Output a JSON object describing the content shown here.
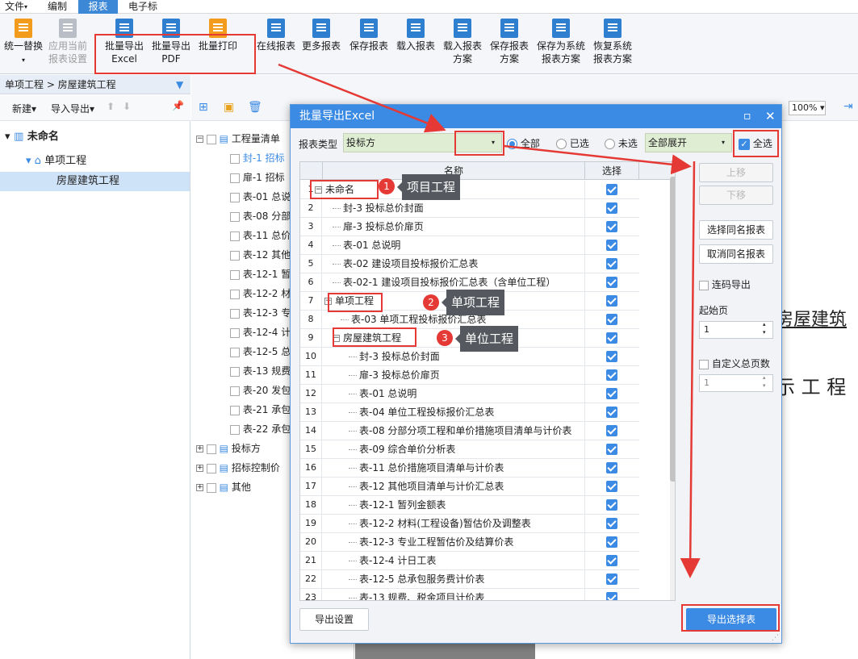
{
  "menu": [
    "文件",
    "编制",
    "报表",
    "电子标"
  ],
  "ribbon": {
    "b1": "统一替换",
    "b2a": "应用当前",
    "b2b": "报表设置",
    "b3a": "批量导出",
    "b3b": "Excel",
    "b4a": "批量导出",
    "b4b": "PDF",
    "b5": "批量打印",
    "b6": "在线报表",
    "b7": "更多报表",
    "b8": "保存报表",
    "b9": "载入报表",
    "b10a": "载入报表",
    "b10b": "方案",
    "b11a": "保存报表",
    "b11b": "方案",
    "b12a": "保存为系统",
    "b12b": "报表方案",
    "b13a": "恢复系统",
    "b13b": "报表方案"
  },
  "breadcrumb": "单项工程 > 房屋建筑工程",
  "side_tool": {
    "new": "新建",
    "io": "导入导出"
  },
  "side_tree": [
    "未命名",
    "单项工程",
    "房屋建筑工程"
  ],
  "zoom": "100%",
  "report_list": [
    "工程量清单",
    "封-1 招标",
    "扉-1 招标",
    "表-01 总说",
    "表-08 分部",
    "表-11 总价",
    "表-12 其他",
    "表-12-1 暂",
    "表-12-2 材",
    "表-12-3 专",
    "表-12-4 计",
    "表-12-5 总",
    "表-13 规费",
    "表-20 发包",
    "表-21 承包",
    "表-22 承包",
    "投标方",
    "招标控制价",
    "其他"
  ],
  "paper_text": {
    "line1": "房屋建筑",
    "line2": "示 工 程"
  },
  "dialog": {
    "title": "批量导出Excel",
    "type_label": "报表类型",
    "type_value": "投标方",
    "filter": [
      "全部",
      "已选",
      "未选"
    ],
    "expand": "全部展开",
    "select_all": "全选",
    "col_name": "名称",
    "col_select": "选择",
    "rows": [
      {
        "no": "1",
        "name": "未命名",
        "level": 0,
        "group": true
      },
      {
        "no": "2",
        "name": "封-3 投标总价封面",
        "level": 1
      },
      {
        "no": "3",
        "name": "扉-3 投标总价扉页",
        "level": 1
      },
      {
        "no": "4",
        "name": "表-01 总说明",
        "level": 1
      },
      {
        "no": "5",
        "name": "表-02 建设项目投标报价汇总表",
        "level": 1
      },
      {
        "no": "6",
        "name": "表-02-1 建设项目投标报价汇总表（含单位工程）",
        "level": 1
      },
      {
        "no": "7",
        "name": "单项工程",
        "level": 1,
        "group": true
      },
      {
        "no": "8",
        "name": "表-03 单项工程投标报价汇总表",
        "level": 2
      },
      {
        "no": "9",
        "name": "房屋建筑工程",
        "level": 2,
        "group": true
      },
      {
        "no": "10",
        "name": "封-3 投标总价封面",
        "level": 3
      },
      {
        "no": "11",
        "name": "扉-3 投标总价扉页",
        "level": 3
      },
      {
        "no": "12",
        "name": "表-01 总说明",
        "level": 3
      },
      {
        "no": "13",
        "name": "表-04 单位工程投标报价汇总表",
        "level": 3
      },
      {
        "no": "14",
        "name": "表-08 分部分项工程和单价措施项目清单与计价表",
        "level": 3
      },
      {
        "no": "15",
        "name": "表-09 综合单价分析表",
        "level": 3
      },
      {
        "no": "16",
        "name": "表-11 总价措施项目清单与计价表",
        "level": 3
      },
      {
        "no": "17",
        "name": "表-12 其他项目清单与计价汇总表",
        "level": 3
      },
      {
        "no": "18",
        "name": "表-12-1 暂列金额表",
        "level": 3
      },
      {
        "no": "19",
        "name": "表-12-2 材料(工程设备)暂估价及调整表",
        "level": 3
      },
      {
        "no": "20",
        "name": "表-12-3 专业工程暂估价及结算价表",
        "level": 3
      },
      {
        "no": "21",
        "name": "表-12-4 计日工表",
        "level": 3
      },
      {
        "no": "22",
        "name": "表-12-5 总承包服务费计价表",
        "level": 3
      },
      {
        "no": "23",
        "name": "表-13 规费、税金项目计价表",
        "level": 3
      }
    ],
    "up": "上移",
    "down": "下移",
    "sel_same": "选择同名报表",
    "cancel_same": "取消同名报表",
    "continuous": "连码导出",
    "start_page": "起始页",
    "start_value": "1",
    "custom_total": "自定义总页数",
    "total_value": "1",
    "export_settings": "导出设置",
    "export": "导出选择表"
  },
  "annotations": [
    {
      "n": "1",
      "text": "项目工程"
    },
    {
      "n": "2",
      "text": "单项工程"
    },
    {
      "n": "3",
      "text": "单位工程"
    }
  ],
  "colors": {
    "accent": "#3b8ae3",
    "annotation": "#e53935"
  }
}
